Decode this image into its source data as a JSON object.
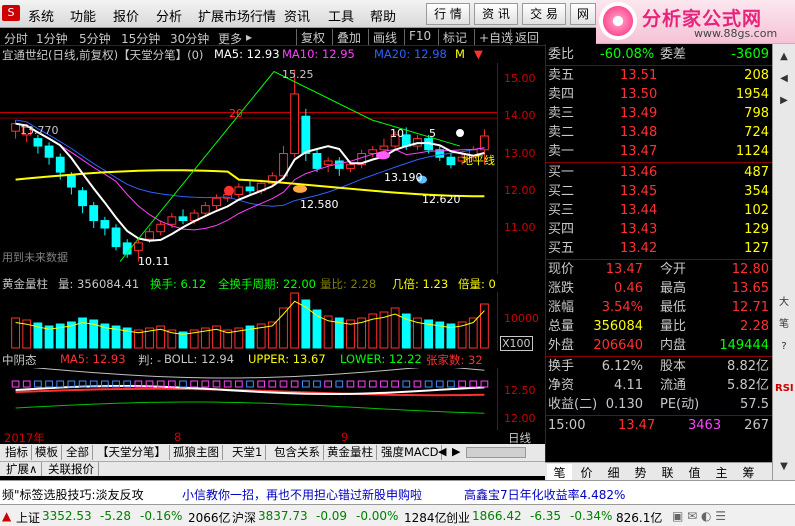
{
  "menu": {
    "items": [
      "系统",
      "功能",
      "报价",
      "分析",
      "扩展市场行情",
      "资讯",
      "工具",
      "帮助"
    ],
    "right_buttons": [
      "行 情",
      "资 讯",
      "交 易",
      "网"
    ]
  },
  "brand": {
    "title": "分析家公式网",
    "url": "www.88gs.com"
  },
  "periods": [
    "分时",
    "1分钟",
    "5分钟",
    "15分钟",
    "30分钟",
    "更多"
  ],
  "period_buttons": [
    "复权",
    "叠加",
    "画线",
    "F10",
    "标记",
    "+自选",
    "返回"
  ],
  "main_title": {
    "stock": "宜通世纪(日线,前复权)【天堂分笔】(0)",
    "ma5": "MA5: 12.93",
    "ma10": "MA10: 12.95",
    "ma20": "MA20: 12.98",
    "flag": "M"
  },
  "main_axis": [
    "15.00",
    "14.00",
    "13.00",
    "12.00",
    "11.00"
  ],
  "chart_labels": {
    "high": "15.25",
    "low": "10.11",
    "left_peak": "13.770",
    "mid_low": "12.580",
    "recent_low": "13.190",
    "recent_low2": "12.620",
    "num_10": "10",
    "num_5": "5",
    "num_20": "20",
    "level": "地平线",
    "future": "用到未来数据"
  },
  "vol_title": {
    "name": "黄金量柱",
    "vol": "量: 356084.41",
    "turnover": "换手: 6.12",
    "all_turnover": "全换手周期: 22.00",
    "ratio": "量比: 2.28",
    "ji": "几倍: 1.23",
    "bei": "倍量: 0"
  },
  "vol_axis": {
    "v": "10000",
    "mult": "X100"
  },
  "boll_title": {
    "name": "中阴态",
    "ma5": "MA5: 12.93",
    "pan": "判: -",
    "boll": "BOLL: 12.94",
    "upper": "UPPER: 13.67",
    "lower": "LOWER: 12.22",
    "zhang": "张家数: 32"
  },
  "boll_axis": [
    "12.50",
    "12.00"
  ],
  "dates": {
    "year": "2017年",
    "m8": "8",
    "m9": "9",
    "period": "日线"
  },
  "tabs": [
    "指标",
    "模板",
    "全部",
    "【天堂分笔】",
    "孤狼主图",
    "天堂1",
    "包含关系",
    "黄金量柱",
    "强度MACD"
  ],
  "tabs2": [
    "扩展∧",
    "关联报价"
  ],
  "quote": {
    "weibi": {
      "label": "委比",
      "val": "-60.08%",
      "label2": "委差",
      "val2": "-3609"
    },
    "sells": [
      {
        "label": "卖五",
        "price": "13.51",
        "vol": "208"
      },
      {
        "label": "卖四",
        "price": "13.50",
        "vol": "1954"
      },
      {
        "label": "卖三",
        "price": "13.49",
        "vol": "798"
      },
      {
        "label": "卖二",
        "price": "13.48",
        "vol": "724"
      },
      {
        "label": "卖一",
        "price": "13.47",
        "vol": "1124"
      }
    ],
    "buys": [
      {
        "label": "买一",
        "price": "13.46",
        "vol": "487"
      },
      {
        "label": "买二",
        "price": "13.45",
        "vol": "354"
      },
      {
        "label": "买三",
        "price": "13.44",
        "vol": "102"
      },
      {
        "label": "买四",
        "price": "13.43",
        "vol": "129"
      },
      {
        "label": "买五",
        "price": "13.42",
        "vol": "127"
      }
    ],
    "stats": [
      {
        "l1": "现价",
        "v1": "13.47",
        "l2": "今开",
        "v2": "12.80"
      },
      {
        "l1": "涨跌",
        "v1": "0.46",
        "l2": "最高",
        "v2": "13.65"
      },
      {
        "l1": "涨幅",
        "v1": "3.54%",
        "l2": "最低",
        "v2": "12.71"
      },
      {
        "l1": "总量",
        "v1": "356084",
        "l2": "量比",
        "v2": "2.28"
      },
      {
        "l1": "外盘",
        "v1": "206640",
        "l2": "内盘",
        "v2": "149444"
      }
    ],
    "stats2": [
      {
        "l1": "换手",
        "v1": "6.12%",
        "l2": "股本",
        "v2": "8.82亿"
      },
      {
        "l1": "净资",
        "v1": "4.11",
        "l2": "流通",
        "v2": "5.82亿"
      },
      {
        "l1": "收益(二)",
        "v1": "0.130",
        "l2": "PE(动)",
        "v2": "57.5"
      }
    ],
    "tick": {
      "time": "15:00",
      "price": "13.47",
      "vol": "3463",
      "n": "267"
    }
  },
  "bottom_tabs": [
    "笔",
    "价",
    "细",
    "势",
    "联",
    "值",
    "主",
    "筹"
  ],
  "sidebar": [
    "▲",
    "◀",
    "▶",
    "大",
    "笔",
    "?",
    "RSI",
    "▼"
  ],
  "ticker": {
    "t1": "频\"标签选股技巧:淡友反攻",
    "t2": "小信教你一招，再也不用担心错过新股申购啦",
    "t3": "高鑫宝7日年化收益率4.482%"
  },
  "status": {
    "sh": {
      "label": "上证",
      "v": "3352.53",
      "chg": "-5.28",
      "pct": "-0.16%",
      "amt": "2066亿"
    },
    "sz": {
      "label": "沪深",
      "v": "3837.73",
      "chg": "-0.09",
      "pct": "-0.00%",
      "amt": "1284亿"
    },
    "cy": {
      "label": "创业",
      "v": "1866.42",
      "chg": "-6.35",
      "pct": "-0.34%",
      "amt": "826.1亿"
    }
  },
  "colors": {
    "up": "#ff3030",
    "down": "#00ffff",
    "accent": "#ffff00",
    "ma_white": "#ffffff"
  }
}
